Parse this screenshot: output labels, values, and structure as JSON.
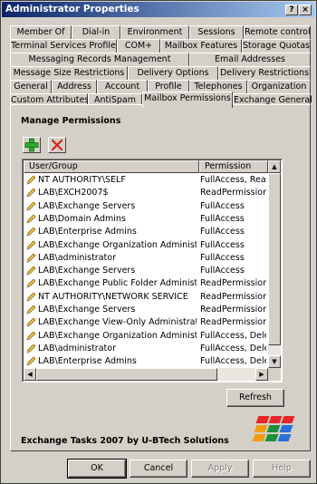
{
  "window": {
    "title": "Administrator Properties",
    "help_glyph": "?",
    "close_glyph": "×"
  },
  "tabs": {
    "row1": [
      "Member Of",
      "Dial-in",
      "Environment",
      "Sessions",
      "Remote control"
    ],
    "row2": [
      "Terminal Services Profile",
      "COM+",
      "Mailbox Features",
      "Storage Quotas"
    ],
    "row3": [
      "Messaging Records Management",
      "Email Addresses"
    ],
    "row4": [
      "Message Size Restrictions",
      "Delivery Options",
      "Delivery Restrictions"
    ],
    "row5": [
      "General",
      "Address",
      "Account",
      "Profile",
      "Telephones",
      "Organization"
    ],
    "row6": [
      "Custom Attributes",
      "AntiSpam",
      "Mailbox Permissions",
      "Exchange General"
    ],
    "active": "Mailbox Permissions"
  },
  "panel": {
    "heading": "Manage Permissions",
    "add_icon": "green-plus-icon",
    "remove_icon": "red-x-icon",
    "columns": {
      "user": "User/Group",
      "permission": "Permission"
    },
    "rows": [
      {
        "user": "NT AUTHORITY\\SELF",
        "permission": "FullAccess, ReadPermission"
      },
      {
        "user": "LAB\\EXCH2007$",
        "permission": "ReadPermission"
      },
      {
        "user": "LAB\\Exchange Servers",
        "permission": "FullAccess"
      },
      {
        "user": "LAB\\Domain Admins",
        "permission": "FullAccess"
      },
      {
        "user": "LAB\\Enterprise Admins",
        "permission": "FullAccess"
      },
      {
        "user": "LAB\\Exchange Organization Administrators",
        "permission": "FullAccess"
      },
      {
        "user": "LAB\\administrator",
        "permission": "FullAccess"
      },
      {
        "user": "LAB\\Exchange Servers",
        "permission": "FullAccess"
      },
      {
        "user": "LAB\\Exchange Public Folder Administrators",
        "permission": "ReadPermission"
      },
      {
        "user": "NT AUTHORITY\\NETWORK SERVICE",
        "permission": "ReadPermission"
      },
      {
        "user": "LAB\\Exchange Servers",
        "permission": "ReadPermission"
      },
      {
        "user": "LAB\\Exchange View-Only Administrators",
        "permission": "ReadPermission"
      },
      {
        "user": "LAB\\Exchange Organization Administrators",
        "permission": "FullAccess, DeleteItem"
      },
      {
        "user": "LAB\\administrator",
        "permission": "FullAccess, DeleteItem"
      },
      {
        "user": "LAB\\Enterprise Admins",
        "permission": "FullAccess, DeleteItem"
      }
    ],
    "refresh_label": "Refresh",
    "footer_text": "Exchange Tasks 2007 by U-BTech Solutions",
    "logo_colors": [
      "#e8262a",
      "#f39c12",
      "#1e8e3e",
      "#2a6fdb"
    ]
  },
  "buttons": {
    "ok": "OK",
    "cancel": "Cancel",
    "apply": "Apply",
    "help": "Help"
  }
}
